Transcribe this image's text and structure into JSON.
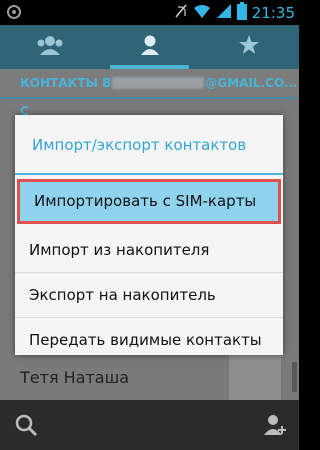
{
  "status_bar": {
    "time": "21:35",
    "icons": [
      "android-debug-icon",
      "no-sim-icon",
      "wifi-icon",
      "signal-icon",
      "battery-icon"
    ],
    "accent_color": "#33b5e5"
  },
  "tabs": [
    {
      "icon": "groups-icon",
      "active": false
    },
    {
      "icon": "person-icon",
      "active": true
    },
    {
      "icon": "star-icon",
      "active": false
    }
  ],
  "account_header": {
    "prefix": "КОНТАКТЫ В ",
    "suffix": "@GMAIL.CO..."
  },
  "section_letter": "С",
  "background_contact": "Тетя Наташа",
  "dialog": {
    "title": "Импорт/экспорт контактов",
    "items": [
      "Импортировать с SIM-карты",
      "Импорт из накопителя",
      "Экспорт на накопитель",
      "Передать видимые контакты"
    ],
    "highlighted_index": 0,
    "accent_color": "#33a5d6",
    "highlight_border_color": "#e05050"
  },
  "bottom_bar": {
    "left_icon": "search-icon",
    "right_icon": "add-contact-icon"
  }
}
